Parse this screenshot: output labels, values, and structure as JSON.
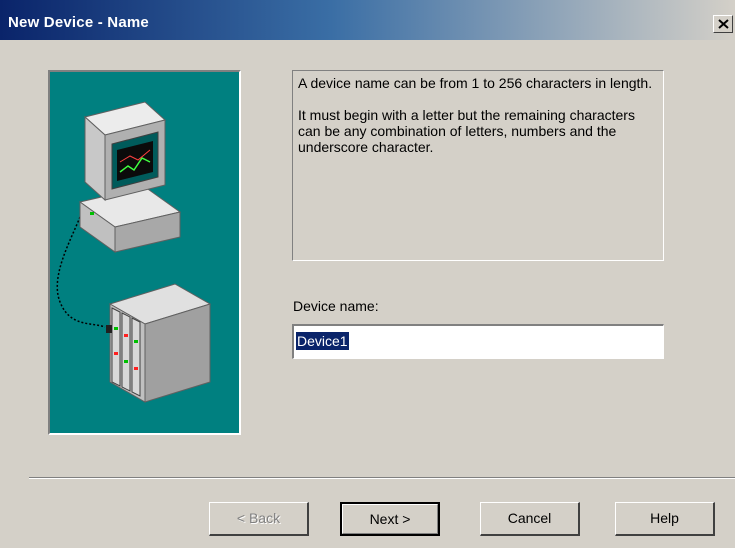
{
  "window": {
    "title": "New Device - Name"
  },
  "info": {
    "paragraph1": "A device name can be from 1 to 256 characters in length.",
    "paragraph2": "It must begin with a letter but the remaining characters can be any combination of letters, numbers and the underscore character."
  },
  "device_name": {
    "label": "Device name:",
    "value": "Device1"
  },
  "buttons": {
    "back": "< Back",
    "next": "Next >",
    "cancel": "Cancel",
    "help": "Help"
  },
  "icons": {
    "close": "close-icon",
    "illustration": "computer-connected-to-device-rack"
  },
  "colors": {
    "title_bar": "#0a246a",
    "illustration_bg": "#008080",
    "selection": "#0a246a",
    "dialog_bg": "#d4d0c8"
  }
}
